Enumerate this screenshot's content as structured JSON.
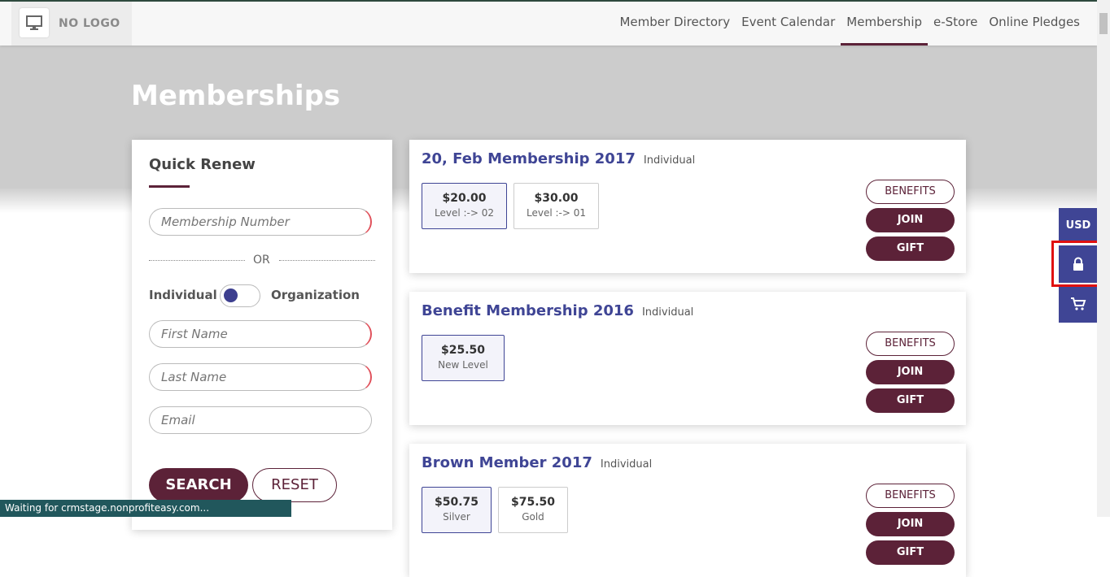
{
  "header": {
    "logo_text": "NO LOGO",
    "logo_icon": "monitor-icon",
    "nav": [
      {
        "label": "Member Directory",
        "active": false
      },
      {
        "label": "Event Calendar",
        "active": false
      },
      {
        "label": "Membership",
        "active": true
      },
      {
        "label": "e-Store",
        "active": false
      },
      {
        "label": "Online Pledges",
        "active": false
      }
    ]
  },
  "page": {
    "title": "Memberships"
  },
  "quick_renew": {
    "title": "Quick Renew",
    "membership_number_placeholder": "Membership Number",
    "or_text": "OR",
    "toggle_left": "Individual",
    "toggle_right": "Organization",
    "first_name_placeholder": "First Name",
    "last_name_placeholder": "Last Name",
    "email_placeholder": "Email",
    "search_label": "SEARCH",
    "reset_label": "RESET"
  },
  "memberships": [
    {
      "title": "20, Feb Membership 2017",
      "type": "Individual",
      "levels": [
        {
          "price": "$20.00",
          "name": "Level :-> 02",
          "selected": true
        },
        {
          "price": "$30.00",
          "name": "Level :-> 01",
          "selected": false
        }
      ],
      "benefits_label": "BENEFITS",
      "join_label": "JOIN",
      "gift_label": "GIFT"
    },
    {
      "title": "Benefit Membership 2016",
      "type": "Individual",
      "levels": [
        {
          "price": "$25.50",
          "name": "New Level",
          "selected": true
        }
      ],
      "benefits_label": "BENEFITS",
      "join_label": "JOIN",
      "gift_label": "GIFT"
    },
    {
      "title": "Brown Member 2017",
      "type": "Individual",
      "levels": [
        {
          "price": "$50.75",
          "name": "Silver",
          "selected": true
        },
        {
          "price": "$75.50",
          "name": "Gold",
          "selected": false
        }
      ],
      "benefits_label": "BENEFITS",
      "join_label": "JOIN",
      "gift_label": "GIFT"
    }
  ],
  "side_widget": {
    "currency": "USD",
    "lock_icon": "lock-icon",
    "cart_icon": "cart-icon"
  },
  "status_bar": {
    "text": "Waiting for crmstage.nonprofiteasy.com..."
  },
  "colors": {
    "primary": "#5c2238",
    "accent": "#3f4595",
    "banner": "#cccccc",
    "highlight": "#e01010"
  }
}
